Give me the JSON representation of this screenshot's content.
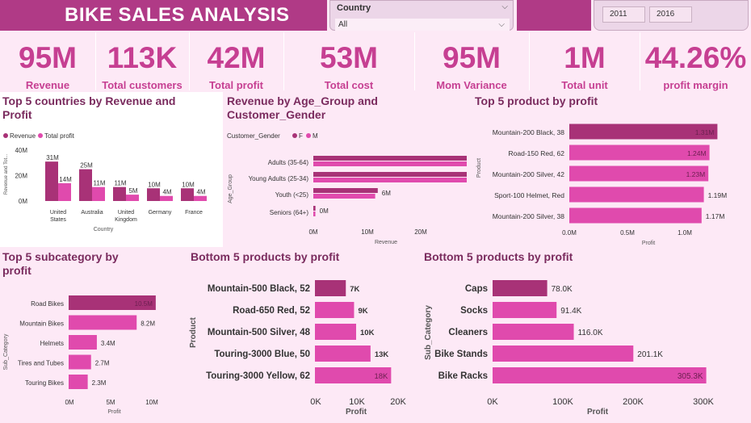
{
  "header": {
    "title": "BIKE SALES ANALYSIS",
    "country_label": "Country",
    "country_value": "All",
    "year_from": "2011",
    "year_to": "2016"
  },
  "kpis": [
    {
      "value": "95M",
      "label": "Revenue"
    },
    {
      "value": "113K",
      "label": "Total customers"
    },
    {
      "value": "42M",
      "label": "Total profit"
    },
    {
      "value": "53M",
      "label": "Total cost"
    },
    {
      "value": "95M",
      "label": "Mom Variance"
    },
    {
      "value": "1M",
      "label": "Total unit"
    },
    {
      "value": "44.26%",
      "label": "profit margin"
    }
  ],
  "colors": {
    "primary": "#a83277",
    "secondary": "#e04aad",
    "kpi": "#c63f92",
    "title_bar": "#b03a86"
  },
  "chart_data": [
    {
      "id": "countries",
      "type": "bar",
      "title": "Top 5 countries by Revenue and Profit",
      "ylabel": "Revenue and Tot...",
      "xlabel": "Country",
      "legend": [
        "Revenue",
        "Total profit"
      ],
      "categories": [
        "United States",
        "Australia",
        "United Kingdom",
        "Germany",
        "France"
      ],
      "series": [
        {
          "name": "Revenue",
          "values": [
            31,
            25,
            11,
            10,
            10
          ],
          "labels": [
            "31M",
            "25M",
            "11M",
            "10M",
            "10M"
          ]
        },
        {
          "name": "Total profit",
          "values": [
            14,
            11,
            5,
            4,
            4
          ],
          "labels": [
            "14M",
            "11M",
            "5M",
            "4M",
            "4M"
          ]
        }
      ],
      "yticks": [
        "40M",
        "20M",
        "0M"
      ],
      "ylim": [
        0,
        40
      ]
    },
    {
      "id": "agegroup",
      "type": "bar",
      "title": "Revenue by Age_Group and Customer_Gender",
      "legend_title": "Customer_Gender",
      "legend": [
        "F",
        "M"
      ],
      "ylabel": "Age_Group",
      "xlabel": "Revenue",
      "categories": [
        "Adults (35-64)",
        "Young Adults (25-34)",
        "Youth (<25)",
        "Seniors (64+)"
      ],
      "series": [
        {
          "name": "F",
          "values": [
            24,
            17,
            6,
            0.2
          ],
          "labels": [
            "24M",
            "17M",
            "6M",
            "0M"
          ]
        },
        {
          "name": "M",
          "values": [
            24,
            17,
            6,
            0.2
          ],
          "labels": [
            "24M",
            "17M",
            "6M",
            "0M"
          ]
        }
      ],
      "xticks": [
        "0M",
        "10M",
        "20M"
      ],
      "xlim": [
        0,
        28
      ]
    },
    {
      "id": "topproducts",
      "type": "bar",
      "title": "Top 5 product by profit",
      "ylabel": "Product",
      "xlabel": "Profit",
      "categories": [
        "Mountain-200 Black, 38",
        "Road-150 Red, 62",
        "Mountain-200 Silver, 42",
        "Sport-100 Helmet, Red",
        "Mountain-200 Silver, 38"
      ],
      "values": [
        1.31,
        1.24,
        1.23,
        1.19,
        1.17
      ],
      "labels": [
        "1.31M",
        "1.24M",
        "1.23M",
        "1.19M",
        "1.17M"
      ],
      "xticks": [
        "0.0M",
        "0.5M",
        "1.0M"
      ],
      "xlim": [
        0,
        1.4
      ]
    },
    {
      "id": "subcategory",
      "type": "bar",
      "title": "Top 5 subcategory by profit",
      "ylabel": "Sub_Category",
      "xlabel": "Profit",
      "categories": [
        "Road Bikes",
        "Mountain Bikes",
        "Helmets",
        "Tires and Tubes",
        "Touring Bikes"
      ],
      "values": [
        10.5,
        8.2,
        3.4,
        2.7,
        2.3
      ],
      "labels": [
        "10.5M",
        "8.2M",
        "3.4M",
        "2.7M",
        "2.3M"
      ],
      "xticks": [
        "0M",
        "5M",
        "10M"
      ],
      "xlim": [
        0,
        11
      ]
    },
    {
      "id": "bottomproducts",
      "type": "bar",
      "title": "Bottom 5 products by profit",
      "ylabel": "Product",
      "xlabel": "Profit",
      "categories": [
        "Mountain-500 Black, 52",
        "Road-650 Red, 52",
        "Mountain-500 Silver, 48",
        "Touring-3000 Blue, 50",
        "Touring-3000 Yellow, 62"
      ],
      "values": [
        7.5,
        9.5,
        10,
        13.5,
        18.5
      ],
      "labels": [
        "7K",
        "9K",
        "10K",
        "13K",
        "18K"
      ],
      "xticks": [
        "0K",
        "10K",
        "20K"
      ],
      "xlim": [
        0,
        20
      ]
    },
    {
      "id": "bottomsubcat",
      "type": "bar",
      "title": "Bottom 5 products by profit",
      "ylabel": "Sub_Category",
      "xlabel": "Profit",
      "categories": [
        "Caps",
        "Socks",
        "Cleaners",
        "Bike Stands",
        "Bike Racks"
      ],
      "values": [
        78.0,
        91.4,
        116.0,
        201.1,
        305.3
      ],
      "labels": [
        "78.0K",
        "91.4K",
        "116.0K",
        "201.1K",
        "305.3K"
      ],
      "xticks": [
        "0K",
        "100K",
        "200K",
        "300K"
      ],
      "xlim": [
        0,
        300
      ]
    }
  ]
}
